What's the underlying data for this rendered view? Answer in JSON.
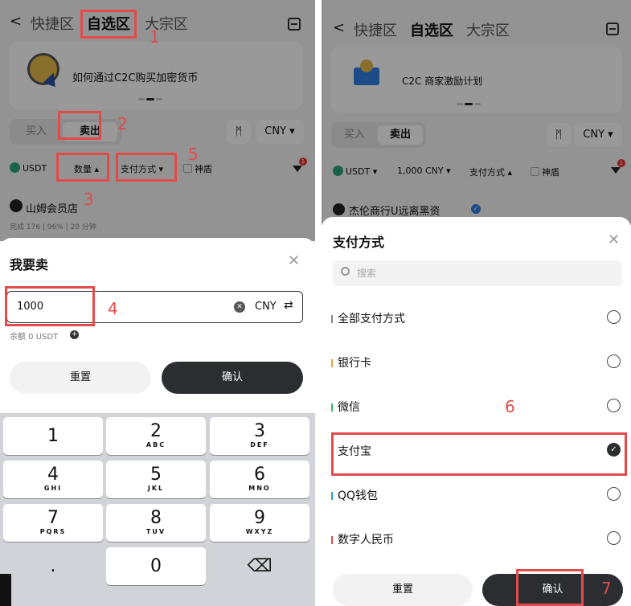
{
  "left": {
    "header": {
      "back": "<",
      "tabs": [
        "快捷区",
        "自选区",
        "大宗区"
      ],
      "active_tab": 1
    },
    "banner": {
      "text": "如何通过C2C购买加密货币"
    },
    "segment": {
      "buy": "买入",
      "sell": "卖出",
      "selected": "sell"
    },
    "currency_chip": "CNY ▾",
    "filters": {
      "coin": "USDT",
      "amount": "数量 ▴",
      "payment": "支付方式 ▾",
      "shield": "神盾"
    },
    "merchant": {
      "name": "山姆会员店",
      "stats": "完成 176 | 96% | 20 分钟"
    },
    "sheet": {
      "title": "我要卖",
      "amount_value": "1000",
      "currency": "CNY",
      "balance": "余额 0 USDT",
      "reset": "重置",
      "confirm": "确认"
    },
    "keypad": [
      {
        "d": "1",
        "l": ""
      },
      {
        "d": "2",
        "l": "ABC"
      },
      {
        "d": "3",
        "l": "DEF"
      },
      {
        "d": "4",
        "l": "GHI"
      },
      {
        "d": "5",
        "l": "JKL"
      },
      {
        "d": "6",
        "l": "MNO"
      },
      {
        "d": "7",
        "l": "PQRS"
      },
      {
        "d": "8",
        "l": "TUV"
      },
      {
        "d": "9",
        "l": "WXYZ"
      },
      {
        "d": ".",
        "l": ""
      },
      {
        "d": "0",
        "l": ""
      },
      {
        "d": "⌫",
        "l": ""
      }
    ]
  },
  "right": {
    "header": {
      "back": "<",
      "tabs": [
        "快捷区",
        "自选区",
        "大宗区"
      ],
      "active_tab": 1
    },
    "banner": {
      "text": "C2C 商家激励计划"
    },
    "segment": {
      "buy": "买入",
      "sell": "卖出",
      "selected": "sell"
    },
    "currency_chip": "CNY ▾",
    "filters": {
      "coin": "USDT ▾",
      "amount": "1,000 CNY ▾",
      "payment": "支付方式 ▴",
      "shield": "神盾"
    },
    "merchant": {
      "name": "杰伦商行U远离黑资"
    },
    "sheet": {
      "title": "支付方式",
      "search_placeholder": "搜索",
      "options": [
        {
          "label": "全部支付方式",
          "bar_color": "#888888",
          "selected": false
        },
        {
          "label": "银行卡",
          "bar_color": "#f0a040",
          "selected": false
        },
        {
          "label": "微信",
          "bar_color": "#3cb371",
          "selected": false
        },
        {
          "label": "支付宝",
          "bar_color": "#2f7de1",
          "selected": true
        },
        {
          "label": "QQ钱包",
          "bar_color": "#2f9de1",
          "selected": false
        },
        {
          "label": "数字人民币",
          "bar_color": "#e05050",
          "selected": false
        }
      ],
      "reset": "重置",
      "confirm": "确认"
    }
  },
  "step_labels": [
    "1",
    "2",
    "3",
    "4",
    "5",
    "6",
    "7"
  ],
  "colors": {
    "accent_red": "#e34b4b",
    "dark_button": "#2b2d31",
    "usdt_green": "#2aa37e"
  },
  "icons": [
    "back-icon",
    "scan-icon",
    "price-chart-icon",
    "funnel-icon",
    "clear-icon",
    "swap-icon",
    "plus-icon",
    "search-icon",
    "close-icon",
    "check-icon",
    "delete-key-icon"
  ]
}
